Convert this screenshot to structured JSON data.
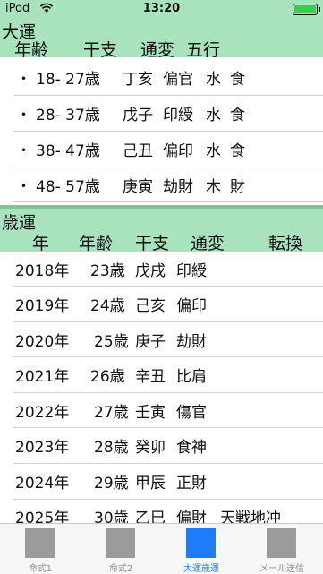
{
  "status": {
    "carrier": "iPod",
    "time": "13:20"
  },
  "taiun": {
    "title": "大運",
    "headers": [
      "年齢",
      "干支",
      "通変",
      "五行"
    ],
    "rows": [
      {
        "bullet": "・",
        "age": "18- 27歳",
        "kanshi": "丁亥",
        "tsuhen": "偏官",
        "gogyo1": "水",
        "gogyo2": "食"
      },
      {
        "bullet": "・",
        "age": "28- 37歳",
        "kanshi": "戊子",
        "tsuhen": "印綬",
        "gogyo1": "水",
        "gogyo2": "食"
      },
      {
        "bullet": "・",
        "age": "38- 47歳",
        "kanshi": "己丑",
        "tsuhen": "偏印",
        "gogyo1": "水",
        "gogyo2": "食"
      },
      {
        "bullet": "・",
        "age": "48- 57歳",
        "kanshi": "庚寅",
        "tsuhen": "劫財",
        "gogyo1": "木",
        "gogyo2": "財"
      }
    ]
  },
  "saiun": {
    "title": "歳運",
    "headers": [
      "年",
      "年齢",
      "干支",
      "通変",
      "転換"
    ],
    "rows": [
      {
        "year": "2018年",
        "age": "23歳",
        "kanshi": "戊戌",
        "tsuhen": "印綬",
        "tenkan": ""
      },
      {
        "year": "2019年",
        "age": "24歳",
        "kanshi": "己亥",
        "tsuhen": "偏印",
        "tenkan": ""
      },
      {
        "year": "2020年",
        "age": "25歳",
        "kanshi": "庚子",
        "tsuhen": "劫財",
        "tenkan": ""
      },
      {
        "year": "2021年",
        "age": "26歳",
        "kanshi": "辛丑",
        "tsuhen": "比肩",
        "tenkan": ""
      },
      {
        "year": "2022年",
        "age": "27歳",
        "kanshi": "壬寅",
        "tsuhen": "傷官",
        "tenkan": ""
      },
      {
        "year": "2023年",
        "age": "28歳",
        "kanshi": "癸卯",
        "tsuhen": "食神",
        "tenkan": ""
      },
      {
        "year": "2024年",
        "age": "29歳",
        "kanshi": "甲辰",
        "tsuhen": "正財",
        "tenkan": ""
      },
      {
        "year": "2025年",
        "age": "30歳",
        "kanshi": "乙巳",
        "tsuhen": "偏財",
        "tenkan": "天戦地冲"
      }
    ]
  },
  "tabs": [
    {
      "label": "命式1",
      "active": false,
      "icon": "placeholder-square-icon"
    },
    {
      "label": "命式2",
      "active": false,
      "icon": "placeholder-square-icon"
    },
    {
      "label": "大運歳運",
      "active": true,
      "icon": "placeholder-square-icon"
    },
    {
      "label": "メール送信",
      "active": false,
      "icon": "placeholder-square-icon"
    }
  ],
  "colors": {
    "header_bg": "#a8e3bd",
    "band": "#7fc697",
    "tab_active": "#1f7cf7",
    "tab_inactive": "#9b9b9b"
  }
}
